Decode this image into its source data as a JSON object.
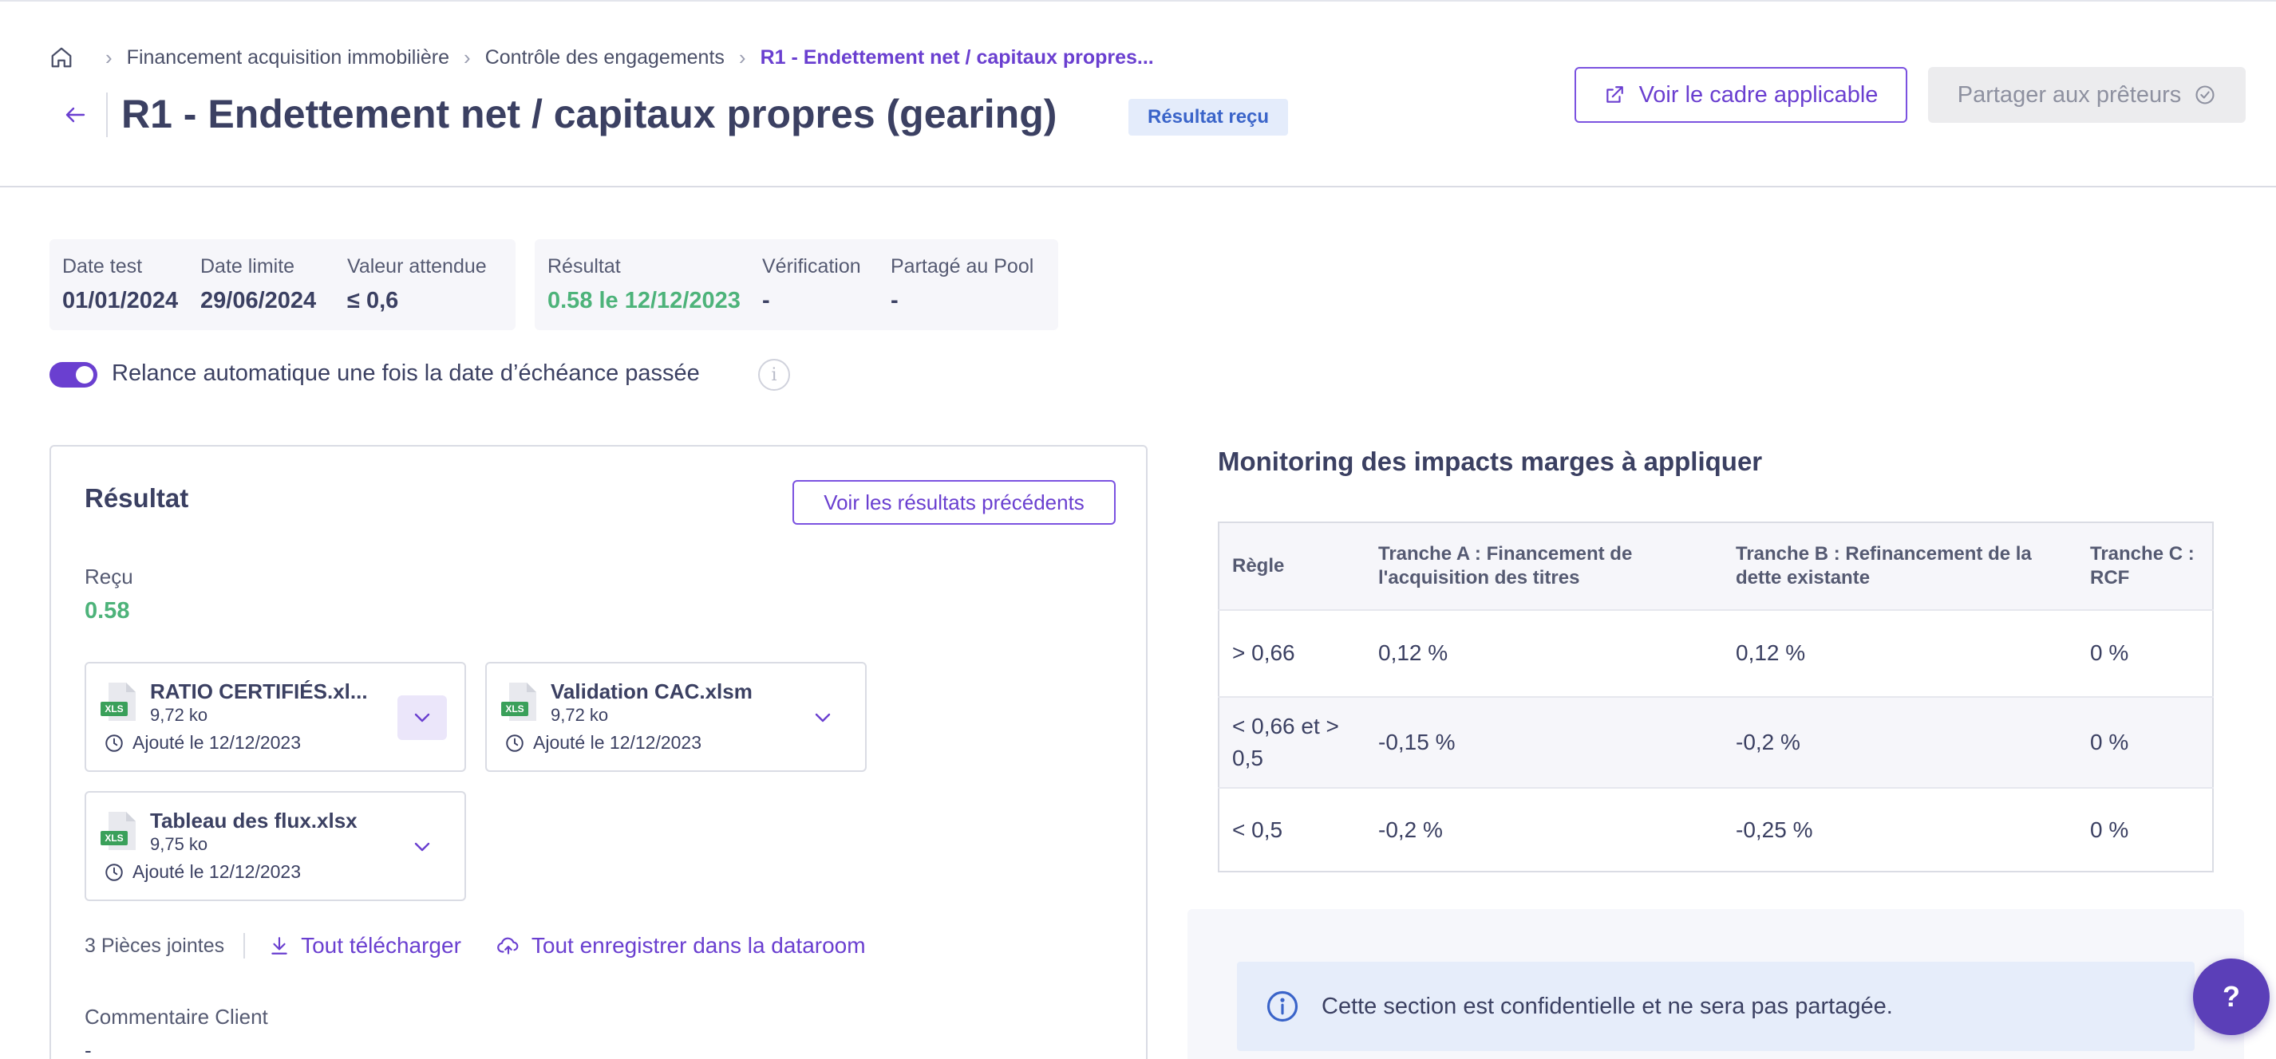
{
  "breadcrumb": {
    "items": [
      "Financement acquisition immobilière",
      "Contrôle des engagements"
    ],
    "current": "R1 - Endettement net / capitaux propres..."
  },
  "header": {
    "title": "R1 - Endettement net / capitaux propres (gearing)",
    "status_badge": "Résultat reçu",
    "view_framework_label": "Voir le cadre applicable",
    "share_lenders_label": "Partager aux prêteurs"
  },
  "info": {
    "date_test_label": "Date test",
    "date_test_value": "01/01/2024",
    "date_limit_label": "Date limite",
    "date_limit_value": "29/06/2024",
    "expected_label": "Valeur attendue",
    "expected_value": "≤ 0,6",
    "result_label": "Résultat",
    "result_value": "0.58 le 12/12/2023",
    "verification_label": "Vérification",
    "verification_value": "-",
    "pool_label": "Partagé au Pool",
    "pool_value": "-"
  },
  "auto_reminder": {
    "label": "Relance automatique une fois la date d’échéance passée",
    "enabled": true
  },
  "result_panel": {
    "title": "Résultat",
    "prev_results_label": "Voir les résultats précédents",
    "received_label": "Reçu",
    "received_value": "0.58",
    "files": [
      {
        "name": "RATIO CERTIFIÉS.xl...",
        "size": "9,72 ko",
        "date": "Ajouté le 12/12/2023",
        "ext": "XLS"
      },
      {
        "name": "Validation CAC.xlsm",
        "size": "9,72 ko",
        "date": "Ajouté le 12/12/2023",
        "ext": "XLS"
      },
      {
        "name": "Tableau des flux.xlsx",
        "size": "9,75 ko",
        "date": "Ajouté le 12/12/2023",
        "ext": "XLS"
      }
    ],
    "attachments_count": "3 Pièces jointes",
    "download_all_label": "Tout télécharger",
    "save_dataroom_label": "Tout enregistrer dans la dataroom",
    "comment_label": "Commentaire Client",
    "comment_value": "-"
  },
  "monitoring": {
    "title": "Monitoring des impacts marges à appliquer",
    "headers": [
      "Règle",
      "Tranche A : Financement de l'acquisition des titres",
      "Tranche B : Refinancement de la dette existante",
      "Tranche C : RCF"
    ],
    "rows": [
      [
        "> 0,66",
        "0,12 %",
        "0,12 %",
        "0 %"
      ],
      [
        "< 0,66 et > 0,5",
        "-0,15 %",
        "-0,2 %",
        "0 %"
      ],
      [
        "< 0,5",
        "-0,2 %",
        "-0,25 %",
        "0 %"
      ]
    ],
    "confidential_text": "Cette section est confidentielle et ne sera pas partagée."
  },
  "help": {
    "label": "?"
  },
  "colors": {
    "accent": "#6a3fd0",
    "success": "#4db37a",
    "badge_bg": "#e4ecfb",
    "badge_text": "#3a64c9"
  }
}
